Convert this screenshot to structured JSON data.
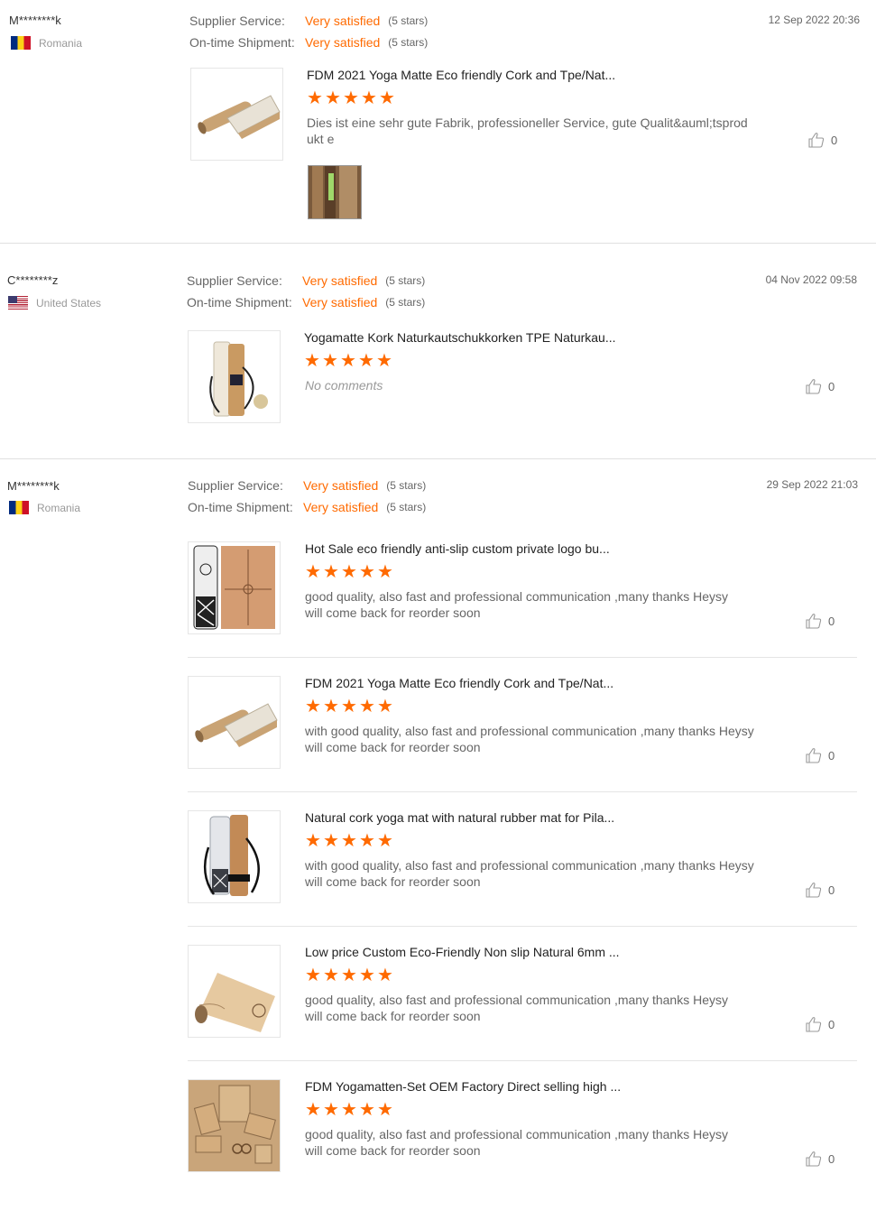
{
  "labels": {
    "supplier_service": "Supplier Service:",
    "on_time_shipment": "On-time Shipment:"
  },
  "colors": {
    "accent": "#ff6a00"
  },
  "reviews": [
    {
      "buyer": "M********k",
      "country": "Romania",
      "country_flag": "romania-flag-icon",
      "date": "12 Sep 2022 20:36",
      "supplier_service": {
        "value": "Very satisfied",
        "stars": "(5 stars)"
      },
      "on_time_shipment": {
        "value": "Very satisfied",
        "stars": "(5 stars)"
      },
      "products": [
        {
          "title": "FDM 2021 Yoga Matte Eco friendly Cork and Tpe/Nat...",
          "rating": 5,
          "comment": "Dies ist eine sehr gute Fabrik, professioneller Service, gute Qualit&auml;tsprodukt e",
          "likes": "0"
        }
      ]
    },
    {
      "buyer": "C********z",
      "country": "United States",
      "country_flag": "united-states-flag-icon",
      "date": "04 Nov 2022 09:58",
      "supplier_service": {
        "value": "Very satisfied",
        "stars": "(5 stars)"
      },
      "on_time_shipment": {
        "value": "Very satisfied",
        "stars": "(5 stars)"
      },
      "products": [
        {
          "title": "Yogamatte Kork Naturkautschukkorken TPE Naturkau...",
          "rating": 5,
          "comment": "No comments",
          "likes": "0"
        }
      ]
    },
    {
      "buyer": "M********k",
      "country": "Romania",
      "country_flag": "romania-flag-icon",
      "date": "29 Sep 2022 21:03",
      "supplier_service": {
        "value": "Very satisfied",
        "stars": "(5 stars)"
      },
      "on_time_shipment": {
        "value": "Very satisfied",
        "stars": "(5 stars)"
      },
      "products": [
        {
          "title": "Hot Sale eco friendly anti-slip custom private logo bu...",
          "rating": 5,
          "comment_line1": "good quality, also fast and professional communication ,many thanks Heysy",
          "comment_line2": "will come back for reorder soon",
          "likes": "0"
        },
        {
          "title": "FDM 2021 Yoga Matte Eco friendly Cork and Tpe/Nat...",
          "rating": 5,
          "comment_line1": "with good quality, also fast and professional communication ,many thanks Heysy",
          "comment_line2": "will come back for reorder soon",
          "likes": "0"
        },
        {
          "title": "Natural cork yoga mat with natural rubber mat for Pila...",
          "rating": 5,
          "comment_line1": "with good quality, also fast and professional communication ,many thanks Heysy",
          "comment_line2": "will come back for reorder soon",
          "likes": "0"
        },
        {
          "title": "Low price Custom Eco-Friendly Non slip Natural 6mm ...",
          "rating": 5,
          "comment_line1": "good quality, also fast and professional communication ,many thanks Heysy",
          "comment_line2": "will come back for reorder soon",
          "likes": "0"
        },
        {
          "title": "FDM Yogamatten-Set OEM Factory Direct selling high ...",
          "rating": 5,
          "comment_line1": "good quality, also fast and professional communication ,many thanks Heysy",
          "comment_line2": "will come back for reorder soon",
          "likes": "0"
        }
      ]
    }
  ]
}
